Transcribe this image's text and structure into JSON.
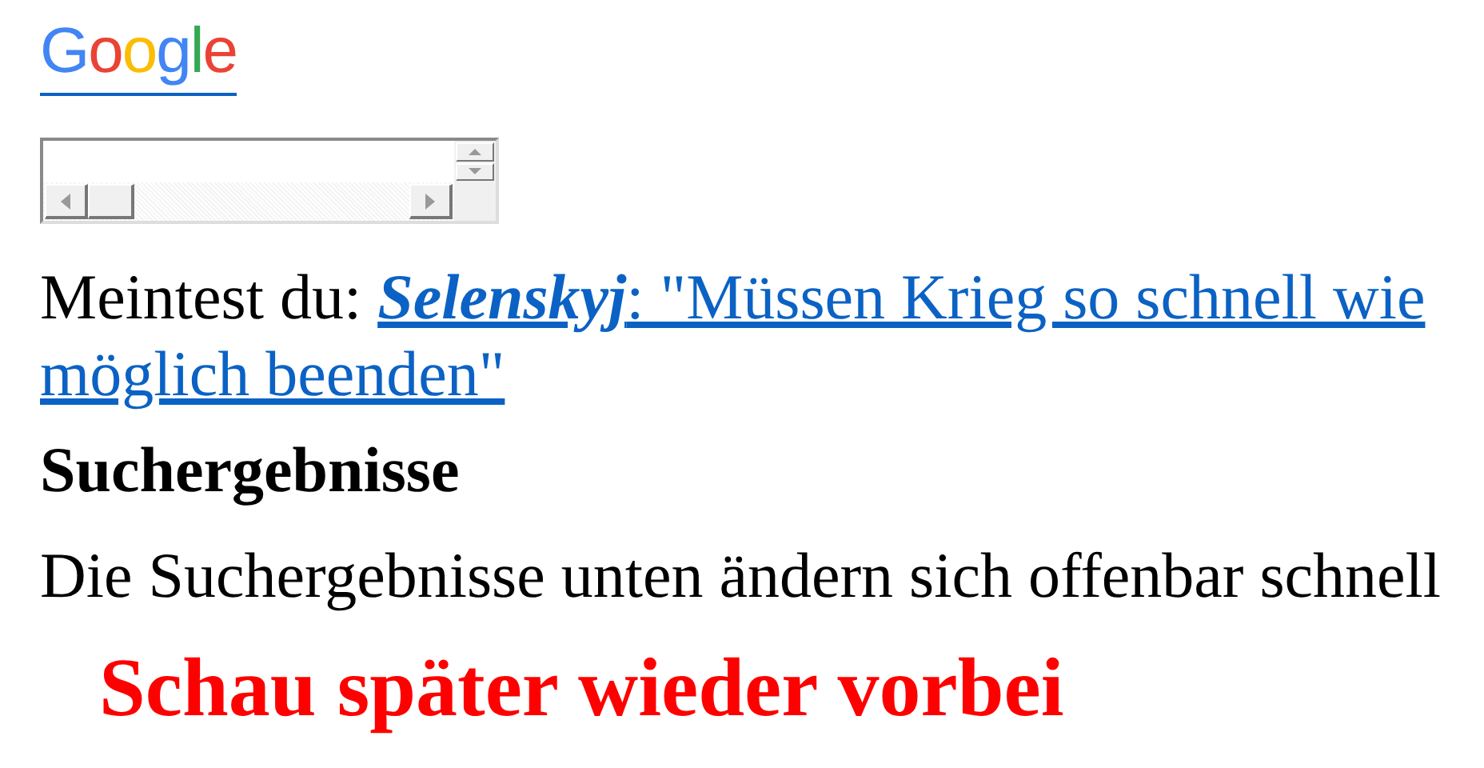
{
  "logo": {
    "text": "Google"
  },
  "suggestion": {
    "label": "Meintest du:",
    "link": "**Selenskyj**: \"Müssen Krieg so schnell wie möglich beenden\""
  },
  "heading": "Suchergebnisse",
  "message": "Die Suchergebnisse unten ändern sich offenbar schnell",
  "notice": "Schau später wieder vorbei"
}
